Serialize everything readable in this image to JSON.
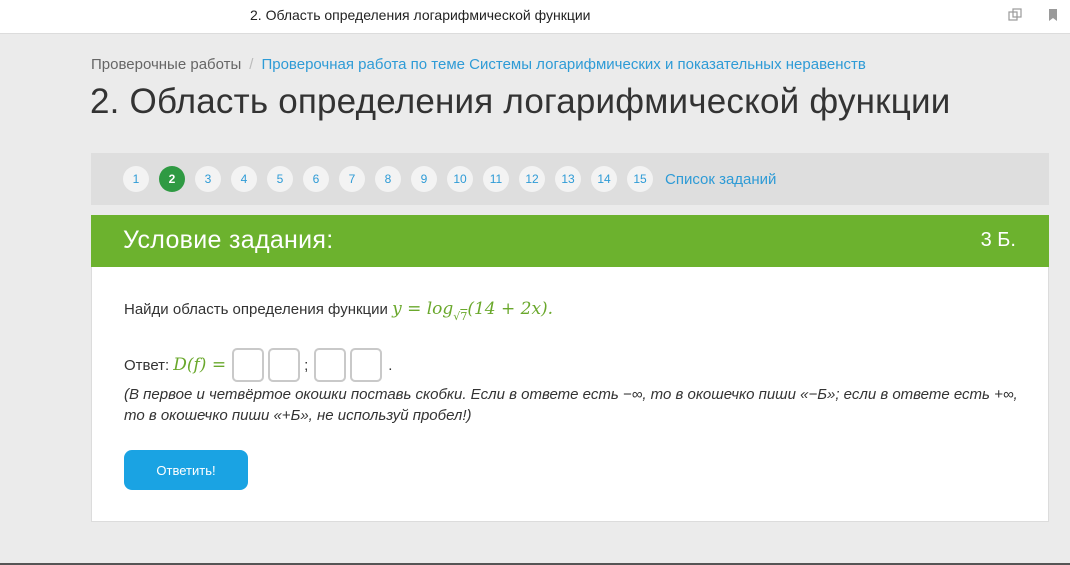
{
  "window": {
    "title": "2. Область определения логарифмической функции",
    "icons": [
      "copy-icon",
      "bookmark-icon"
    ]
  },
  "breadcrumb": {
    "root": "Проверочные работы",
    "separator": "/",
    "current": "Проверочная работа по теме Системы логарифмических и показательных неравенств"
  },
  "page_title": "2. Область определения логарифмической функции",
  "task_nav": {
    "numbers": [
      "1",
      "2",
      "3",
      "4",
      "5",
      "6",
      "7",
      "8",
      "9",
      "10",
      "11",
      "12",
      "13",
      "14",
      "15"
    ],
    "active": "2",
    "list_link": "Список заданий"
  },
  "task": {
    "header_title": "Условие задания:",
    "score": "3 Б.",
    "question_text": "Найди область определения функции",
    "formula": {
      "lhs": "y = ",
      "log": "log",
      "base_sqrt": "√",
      "base_value": "7",
      "argument": "(14 + 2x)",
      "end": "."
    },
    "answer_label": "Ответ:",
    "answer_formula": "D(f) =",
    "separator": ";",
    "end_dot": ".",
    "hint": "(В первое и четвёртое окошки поставь скобки. Если в ответе есть −∞, то в окошечко пиши «−Б»; если в ответе есть +∞, то в окошечко пиши «+Б», не используй пробел!)",
    "submit_label": "Ответить!"
  },
  "colors": {
    "accent_green": "#6cb22e",
    "active_number": "#2f9a43",
    "link_blue": "#2e9bd6",
    "button_blue": "#1aa3e3"
  }
}
